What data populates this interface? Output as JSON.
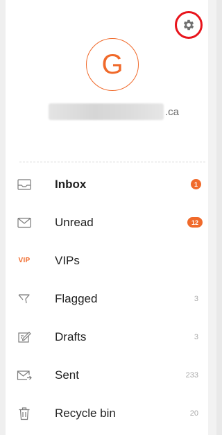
{
  "account": {
    "avatar_letter": "G",
    "email_domain": ".ca"
  },
  "menu": [
    {
      "label": "Inbox",
      "badge": "1",
      "icon": "inbox-icon"
    },
    {
      "label": "Unread",
      "badge": "12",
      "icon": "envelope-icon"
    },
    {
      "label": "VIPs",
      "icon_text": "VIP",
      "icon": "vip-icon"
    },
    {
      "label": "Flagged",
      "count": "3",
      "icon": "flag-icon"
    },
    {
      "label": "Drafts",
      "count": "3",
      "icon": "drafts-icon"
    },
    {
      "label": "Sent",
      "count": "233",
      "icon": "sent-icon"
    },
    {
      "label": "Recycle bin",
      "count": "20",
      "icon": "trash-icon"
    }
  ],
  "colors": {
    "accent": "#f06a2b",
    "highlight_ring": "#e8141c",
    "icon_gray": "#7a7a7a"
  }
}
